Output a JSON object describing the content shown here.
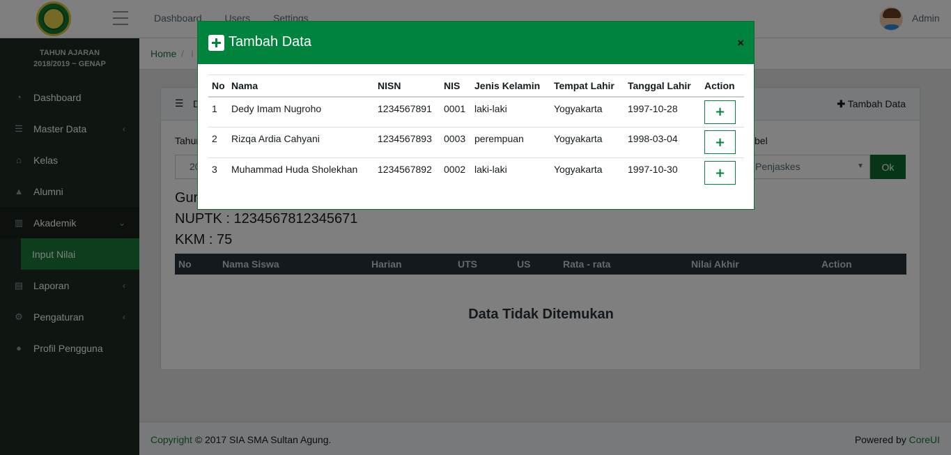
{
  "header": {
    "nav": [
      "Dashboard",
      "Users",
      "Settings"
    ],
    "user": "Admin"
  },
  "sidebar": {
    "year_line1": "TAHUN AJARAN",
    "year_line2": "2018/2019 ~ GENAP",
    "items": [
      {
        "label": "Dashboard",
        "icon": "dashboard-icon"
      },
      {
        "label": "Master Data",
        "icon": "database-icon",
        "caret": "‹"
      },
      {
        "label": "Kelas",
        "icon": "home-icon"
      },
      {
        "label": "Alumni",
        "icon": "graduation-cap-icon"
      },
      {
        "label": "Akademik",
        "icon": "chart-icon",
        "caret": "›"
      },
      {
        "label": "Input Nilai"
      },
      {
        "label": "Laporan",
        "icon": "book-icon",
        "caret": "‹"
      },
      {
        "label": "Pengaturan",
        "icon": "gear-icon",
        "caret": "‹"
      },
      {
        "label": "Profil Pengguna",
        "icon": "user-icon"
      }
    ]
  },
  "breadcrumb": {
    "home": "Home",
    "sep": "/",
    "current": "I"
  },
  "card": {
    "header_title": "D",
    "add_link": "Tambah Data",
    "filter_label_1": "Tahun",
    "filter_value_1": "20",
    "filter_label_2": "bel",
    "filter_value_2": "Penjaskes",
    "ok": "Ok",
    "guru": "Guru",
    "nuptk": "NUPTK : 1234567812345671",
    "kkm": "KKM : 75",
    "columns": [
      "No",
      "Nama Siswa",
      "Harian",
      "UTS",
      "US",
      "Rata - rata",
      "Nilai Akhir",
      "Action"
    ],
    "empty": "Data Tidak Ditemukan"
  },
  "footer": {
    "copyright": "Copyright",
    "copyright_rest": "© 2017 SIA SMA Sultan Agung.",
    "powered": "Powered by",
    "coreui": "CoreUI"
  },
  "modal": {
    "title": "Tambah Data",
    "close": "×",
    "columns": [
      "No",
      "Nama",
      "NISN",
      "NIS",
      "Jenis Kelamin",
      "Tempat Lahir",
      "Tanggal Lahir",
      "Action"
    ],
    "rows": [
      {
        "no": "1",
        "nama": "Dedy Imam Nugroho",
        "nisn": "1234567891",
        "nis": "0001",
        "jk": "laki-laki",
        "tempat": "Yogyakarta",
        "tanggal": "1997-10-28",
        "action": "+"
      },
      {
        "no": "2",
        "nama": "Rizqa Ardia Cahyani",
        "nisn": "1234567893",
        "nis": "0003",
        "jk": "perempuan",
        "tempat": "Yogyakarta",
        "tanggal": "1998-03-04",
        "action": "+"
      },
      {
        "no": "3",
        "nama": "Muhammad Huda Sholekhan",
        "nisn": "1234567892",
        "nis": "0002",
        "jk": "laki-laki",
        "tempat": "Yogyakarta",
        "tanggal": "1997-10-30",
        "action": "+"
      }
    ]
  }
}
